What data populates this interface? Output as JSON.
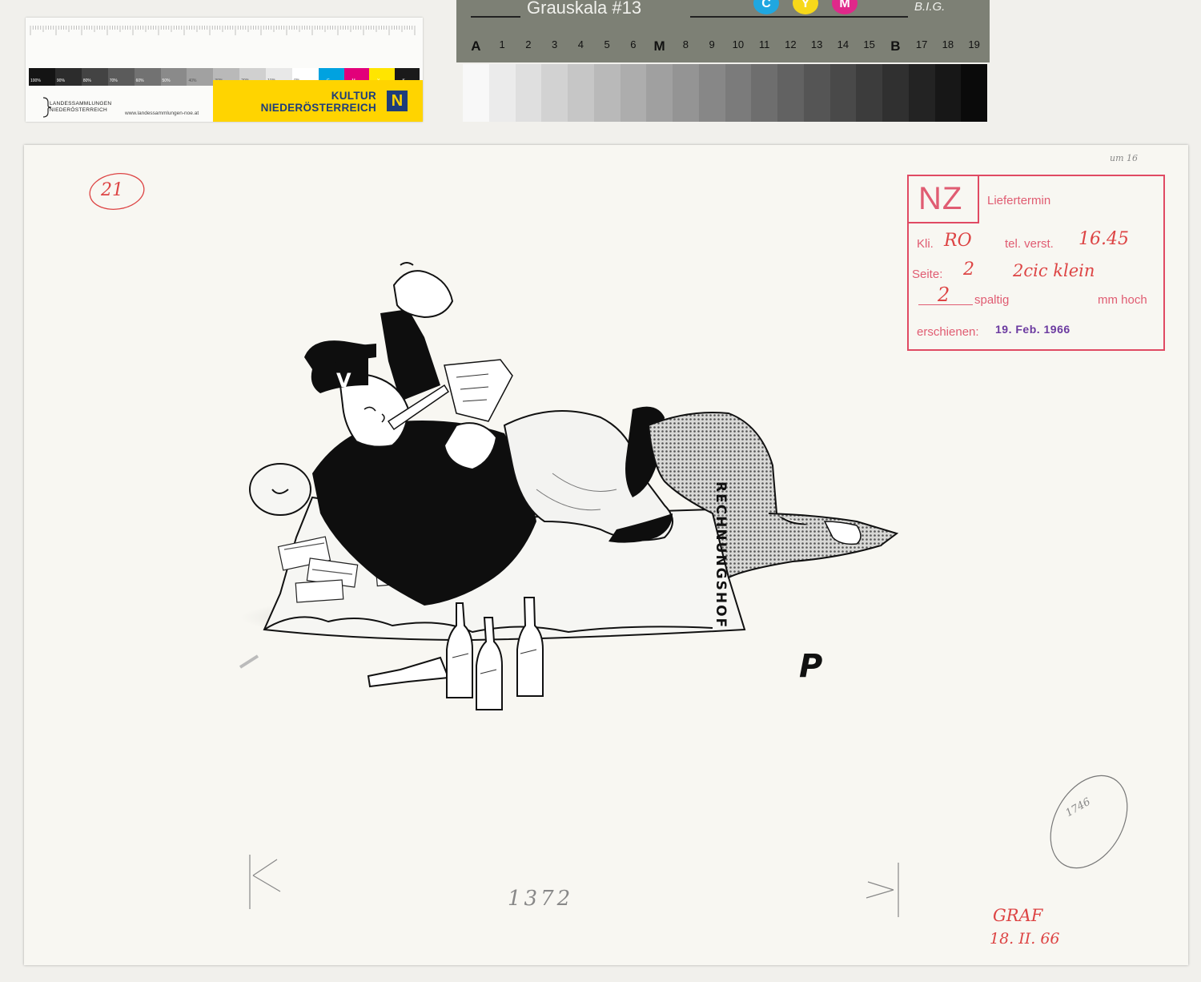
{
  "ruler_card": {
    "gray_patches": [
      "100%",
      "90%",
      "80%",
      "70%",
      "60%",
      "50%",
      "40%",
      "30%",
      "20%",
      "10%",
      "0%"
    ],
    "color_patches": [
      {
        "label": "C",
        "color": "#00a2e0"
      },
      {
        "label": "M",
        "color": "#e2007a"
      },
      {
        "label": "Y",
        "color": "#ffe500"
      },
      {
        "label": "K",
        "color": "#1a1a1a"
      }
    ],
    "landes_text": "LANDESSAMMLUNGEN\nNIEDERÖSTERREICH",
    "landes_url": "www.landessammlungen-noe.at",
    "kultur_text": "KULTUR\nNIEDERÖSTERREICH",
    "kultur_logo": "N"
  },
  "gray_card": {
    "title": "Grauskala #13",
    "brand": "B.I.G.",
    "cmy": [
      {
        "label": "C",
        "color": "#1fa7e1"
      },
      {
        "label": "Y",
        "color": "#f7d81a"
      },
      {
        "label": "M",
        "color": "#e0288a"
      }
    ],
    "labels": [
      "A",
      "1",
      "2",
      "3",
      "4",
      "5",
      "6",
      "M",
      "8",
      "9",
      "10",
      "11",
      "12",
      "13",
      "14",
      "15",
      "B",
      "17",
      "18",
      "19"
    ]
  },
  "sheet": {
    "circled_number": "21",
    "stamp": {
      "nz": "NZ",
      "liefertermin": "Liefertermin",
      "kli_label": "Kli.",
      "kli_value": "RO",
      "tel_label": "tel. verst.",
      "tel_value": "16.45",
      "seite_label": "Seite:",
      "seite_value": "2",
      "seite_note": "2cic klein",
      "spaltig_value": "2",
      "spaltig_label": "spaltig",
      "mm_label": "mm hoch",
      "erschienen_label": "erschienen:",
      "erschienen_value": "19. Feb. 1966"
    },
    "corner_note": "um 16",
    "cartoon_texts": {
      "cap_letter": "V",
      "rechnungshof": "RECHNUNGSHOF",
      "signature": "P"
    },
    "bottom_number": "1372",
    "oval_note": "1746",
    "author_note": "GRAF",
    "author_date": "18. II. 66"
  }
}
